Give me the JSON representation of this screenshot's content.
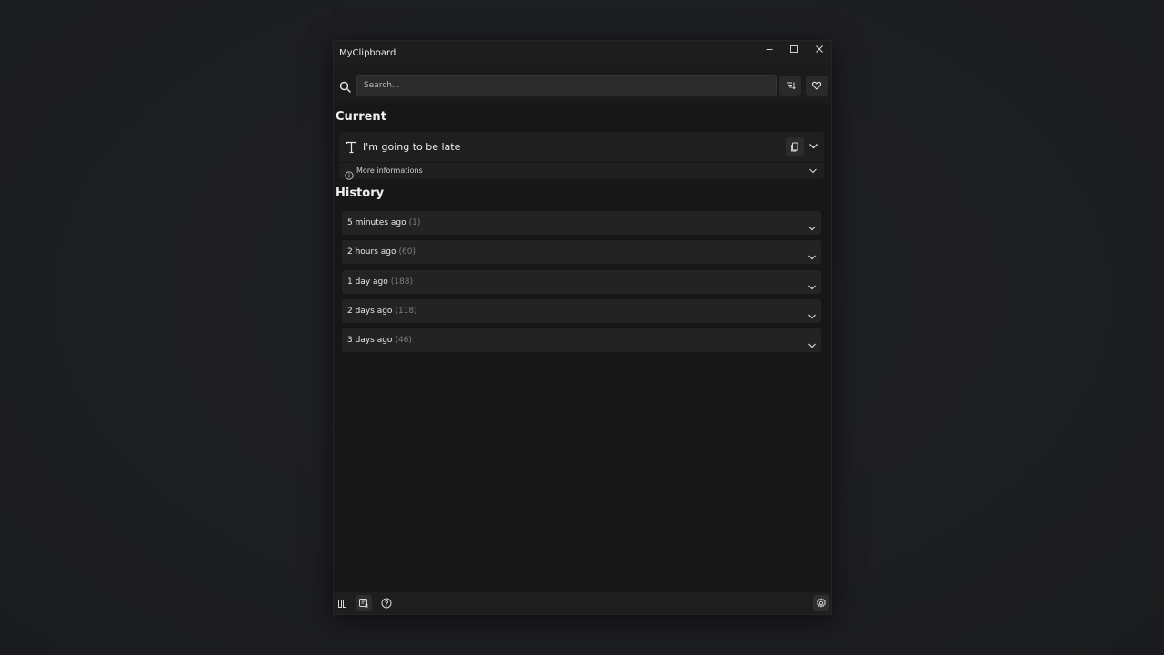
{
  "window": {
    "title": "MyClipboard",
    "controls": [
      "minimize",
      "maximize",
      "close"
    ]
  },
  "search": {
    "placeholder": "Search...",
    "value": ""
  },
  "toolbar": {
    "icons": [
      "search-icon",
      "sort-icon",
      "heart-icon"
    ]
  },
  "current": {
    "section_title": "Current",
    "item_text": "I'm going to be late",
    "item_type_icon": "text-type-icon",
    "more_info_label": "More informations"
  },
  "history": {
    "section_title": "History",
    "groups": [
      {
        "label": "5 minutes ago",
        "count": "(1)"
      },
      {
        "label": "2 hours ago",
        "count": "(60)"
      },
      {
        "label": "1 day ago",
        "count": "(188)"
      },
      {
        "label": "2 days ago",
        "count": "(118)"
      },
      {
        "label": "3 days ago",
        "count": "(46)"
      }
    ]
  },
  "footer": {
    "icons": [
      "pause-icon",
      "clear-history-icon",
      "help-icon",
      "settings-icon"
    ]
  },
  "colors": {
    "desktop": "#1c1d20",
    "window_bg": "#171717",
    "titlebar": "#1d1d1d",
    "card": "#232323",
    "text": "#e8e8e8",
    "muted": "#7d7d7d"
  }
}
